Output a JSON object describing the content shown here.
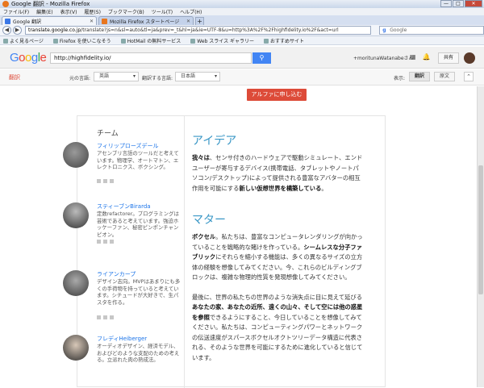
{
  "window": {
    "title": "Google 翻訳 - Mozilla Firefox"
  },
  "menu": [
    "ファイル(F)",
    "編集(E)",
    "表示(V)",
    "履歴(S)",
    "ブックマーク(B)",
    "ツール(T)",
    "ヘルプ(H)"
  ],
  "tabs": [
    {
      "label": "Google 翻訳"
    },
    {
      "label": "Mozilla Firefox スタートページ"
    }
  ],
  "nav": {
    "url_domain": "translate.google.co.jp",
    "url_rest": "/translate?js=n&sl=auto&tl=ja&prev=_t&hl=ja&ie=UTF-8&u=http%3A%2F%2Fhighfidelity.io%2F&act=url",
    "search_placeholder": "Google"
  },
  "bookmarks": [
    "よく見るページ",
    "Firefox を使いこなそう",
    "HotMail の無料サービス",
    "Web スライス ギャラリー",
    "おすすめサイト"
  ],
  "google": {
    "search_value": "http://highfidelity.io/",
    "user": "+moritunaWatanabeさん",
    "share_label": "共有"
  },
  "translate_bar": {
    "brand": "翻訳",
    "source_label": "元の言語:",
    "source_value": "英語",
    "target_label": "翻訳する言語:",
    "target_value": "日本語",
    "display_label": "表示:",
    "translated_btn": "翻訳",
    "original_btn": "原文"
  },
  "alpha_button": "アルファに申し込む",
  "team": {
    "title": "チーム",
    "members": [
      {
        "name": "フィリップローズデール",
        "desc": "アセンブリ言語のツールだと考えています。物理学、オートマトン、エレクトロニクス、ボクシング。"
      },
      {
        "name": "スティーブンBirarda",
        "desc": "定数refactorer。プログラミングは芸術であると考えています。強迫ホッケーファン、秘密ピンポンチャンピオン。"
      },
      {
        "name": "ライアンカープ",
        "desc": "デザイン志向。MVPはあまりにも多くの手荷物を持っていると考えています。シチュードが大好きで、生パスタを作る。"
      },
      {
        "name": "フレディHeiberger",
        "desc": "オーディオデザイン、経済モデル、およびどのような支配のための考える。立派れた肉の熟成法。"
      }
    ]
  },
  "idea": {
    "heading": "アイデア",
    "p1_b1": "我々は",
    "p1_t1": "、センサ付きのハードウェアで駆動シミュレート、エンドユーザーが寄与するデバイス(携帯電話、タブレットやノートパソコン/デスクトップ)によって提供される豊富なアバターの相互作用を可能にする",
    "p1_b2": "新しい仮想世界を構築している",
    "p1_t2": "。"
  },
  "matter": {
    "heading": "マター",
    "p1_b1": "ボクセル",
    "p1_t1": "。私たちは、豊富なコンピュータレンダリングが向かっていることを戦略的な賭けを作っている。",
    "p1_b2": "シームレスな分子ファブリック",
    "p1_t2": "にそれらを縮小する機能は、多くの異なるサイズの立方体の経験を想像してみてください。今、これらのビルディングブロックは、複雑な物理的性質を発現想像してみてください。",
    "p2_t1": "最後に、世界の私たちの世界のような消失点に目に見えて延びる",
    "p2_b1": "あなたの家、あなたの近所、遠くの山々、そして空には他の惑星を参照",
    "p2_t2": "できるようにすること、今日していることを想像してみてください。私たちは、コンピューティングパワーとネットワークの伝送速度がスパースボクセルオクトツリーデータ構造に代表される、そのような世界を可能にするために進化していると信じています。"
  },
  "colors": {
    "accent": "#3a97c6",
    "google_blue": "#4285f4",
    "translate_red": "#dd4b39"
  }
}
